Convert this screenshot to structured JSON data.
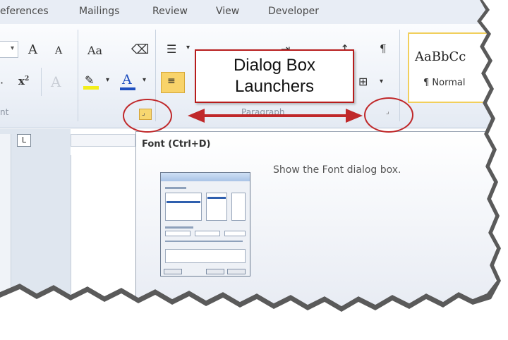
{
  "tabs": [
    {
      "label": "eferences"
    },
    {
      "label": "Mailings"
    },
    {
      "label": "Review"
    },
    {
      "label": "View"
    },
    {
      "label": "Developer"
    }
  ],
  "ribbon": {
    "grow_font": "A",
    "shrink_font": "A",
    "change_case": "Aa",
    "superscript": "x",
    "styles_sample": "AaBbCc",
    "styles_name": "¶ Normal",
    "font_group_label": "nt",
    "paragraph_group_label": "Paragraph",
    "paragraph_mark": "¶"
  },
  "callout": {
    "line1": "Dialog Box",
    "line2": "Launchers"
  },
  "doc": {
    "tab_selector": "L"
  },
  "tooltip": {
    "title": "Font (Ctrl+D)",
    "description": "Show the Font dialog box."
  },
  "colors": {
    "accent_red": "#c0282a",
    "highlight_yellow": "#f8d36a",
    "font_color_blue": "#1f4fbf"
  }
}
